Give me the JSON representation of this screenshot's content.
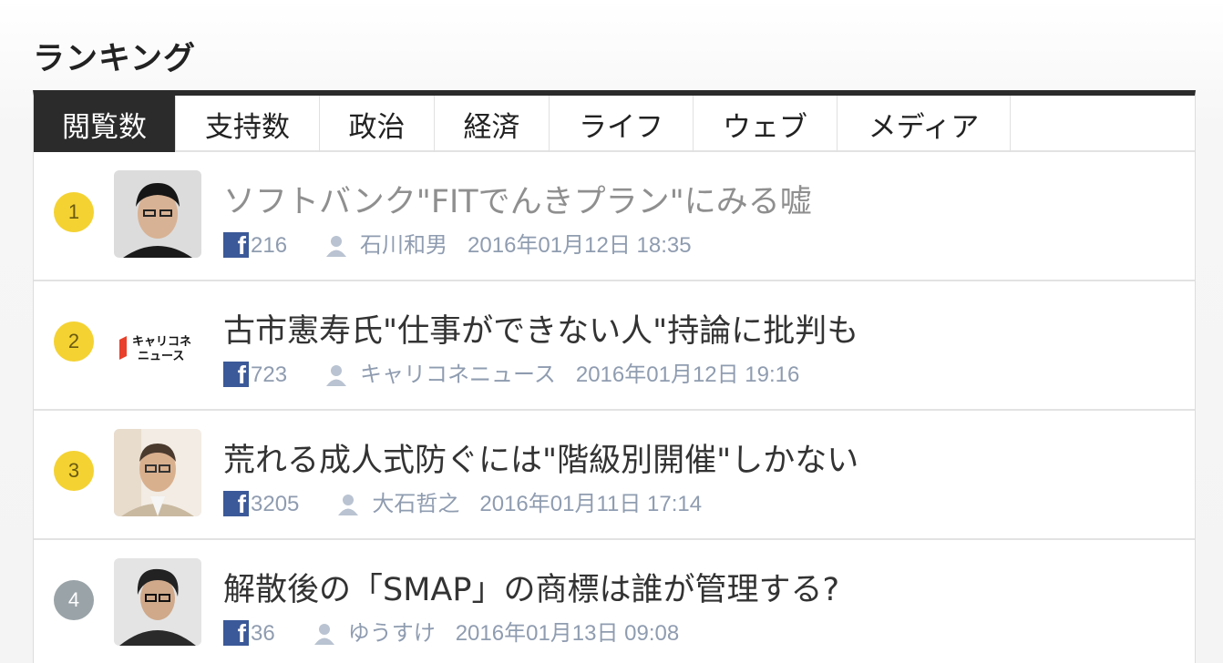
{
  "section_title": "ランキング",
  "tabs": [
    {
      "label": "閲覧数",
      "active": true
    },
    {
      "label": "支持数"
    },
    {
      "label": "政治"
    },
    {
      "label": "経済"
    },
    {
      "label": "ライフ"
    },
    {
      "label": "ウェブ"
    },
    {
      "label": "メディア"
    }
  ],
  "items": [
    {
      "rank": "1",
      "title": "ソフトバンク\"FITでんきプラン\"にみる嘘",
      "fb_count": "216",
      "author": "石川和男",
      "date": "2016年01月12日 18:35"
    },
    {
      "rank": "2",
      "title": "古市憲寿氏\"仕事ができない人\"持論に批判も",
      "fb_count": "723",
      "author": "キャリコネニュース",
      "date": "2016年01月12日 19:16",
      "logo_text_1": "キャリコネ",
      "logo_text_2": "ニュース"
    },
    {
      "rank": "3",
      "title": "荒れる成人式防ぐには\"階級別開催\"しかない",
      "fb_count": "3205",
      "author": "大石哲之",
      "date": "2016年01月11日 17:14"
    },
    {
      "rank": "4",
      "title": "解散後の「SMAP」の商標は誰が管理する?",
      "fb_count": "36",
      "author": "ゆうすけ",
      "date": "2016年01月13日 09:08"
    }
  ],
  "colors": {
    "tab_active_bg": "#2b2b2b",
    "rank_gold": "#f4d232",
    "rank_grey": "#9aa3a8",
    "facebook": "#3b5998",
    "meta_text": "#8f9cb0"
  },
  "icons": {
    "facebook": "facebook-icon",
    "user": "user-icon"
  }
}
